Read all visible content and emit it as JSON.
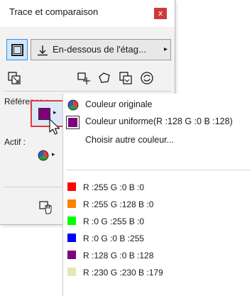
{
  "palette": {
    "title": "Trace et comparaison",
    "close_glyph": "x",
    "placement": {
      "label": "En-dessous de l'étag...",
      "arrow": "▸"
    },
    "reference_label": "Référence :",
    "active_label": "Actif :",
    "reference_color": "#800080"
  },
  "menu": {
    "original_label": "Couleur originale",
    "uniform_label": "Couleur uniforme(R :128 G :0 B :128)",
    "choose_label": "Choisir autre couleur...",
    "colors": [
      {
        "label": "R :255 G :0 B :0",
        "hex": "#ff0000"
      },
      {
        "label": "R :255 G :128 B :0",
        "hex": "#ff8000"
      },
      {
        "label": "R :0 G :255 B :0",
        "hex": "#00ff00"
      },
      {
        "label": "R :0 G :0 B :255",
        "hex": "#0000ff"
      },
      {
        "label": "R :128 G :0 B :128",
        "hex": "#800080"
      },
      {
        "label": "R :230 G :230 B :179",
        "hex": "#e6e6b3"
      }
    ]
  },
  "icons": [
    "toggle-trace-icon",
    "below-floor-icon",
    "swap-icon",
    "move-icon",
    "rotate-icon",
    "mirror-icon",
    "reset-icon",
    "pie-color-icon",
    "cursor-icon",
    "hand-icon"
  ]
}
